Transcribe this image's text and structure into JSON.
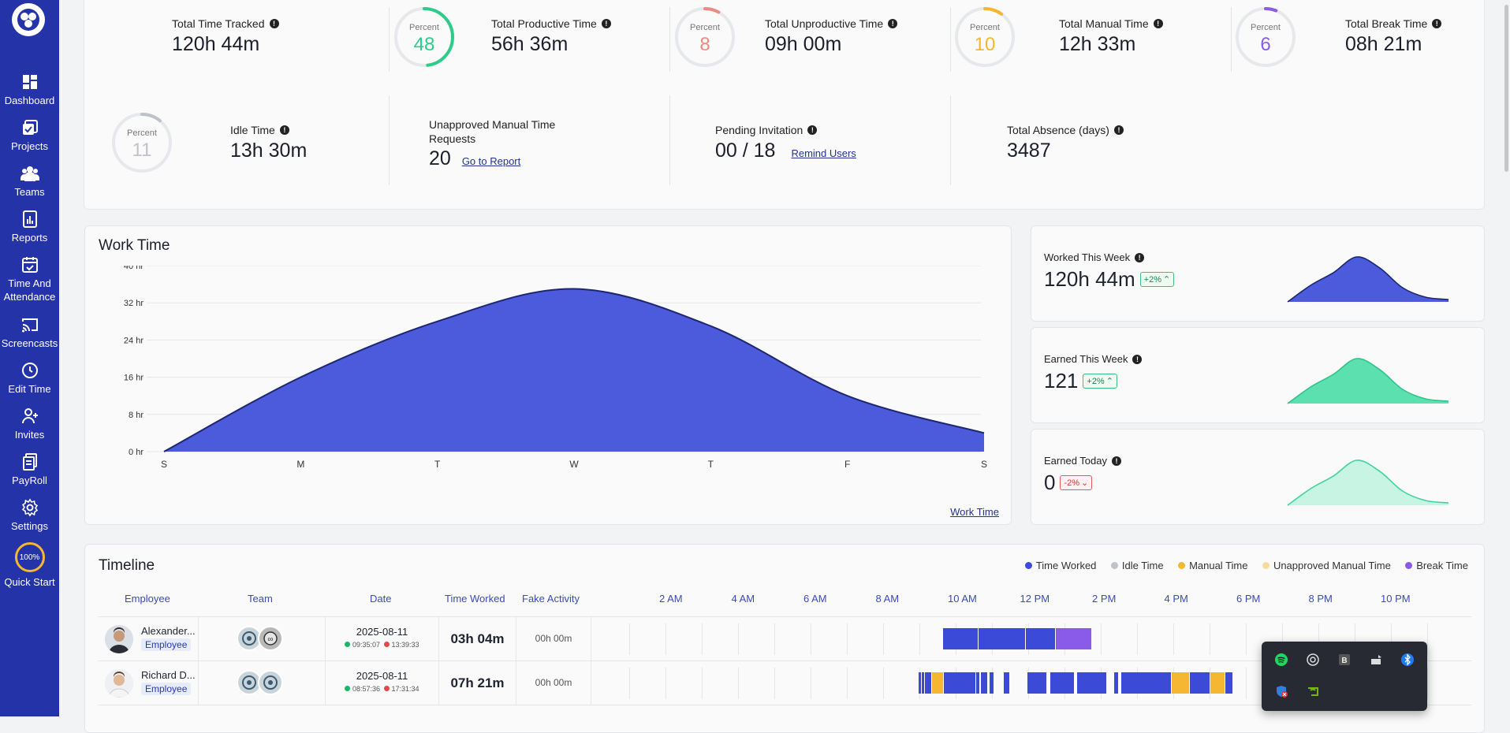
{
  "sidebar": {
    "items": [
      {
        "label": "Dashboard",
        "icon": "dashboard-icon"
      },
      {
        "label": "Projects",
        "icon": "projects-icon"
      },
      {
        "label": "Teams",
        "icon": "teams-icon"
      },
      {
        "label": "Reports",
        "icon": "reports-icon"
      },
      {
        "label": "Time And Attendance",
        "icon": "calendar-icon"
      },
      {
        "label": "Screencasts",
        "icon": "screencast-icon"
      },
      {
        "label": "Edit Time",
        "icon": "clock-icon"
      },
      {
        "label": "Invites",
        "icon": "add-user-icon"
      },
      {
        "label": "PayRoll",
        "icon": "payroll-icon"
      },
      {
        "label": "Settings",
        "icon": "gear-icon"
      }
    ],
    "quick_start": {
      "label": "Quick Start",
      "percent": "100%"
    }
  },
  "stats": {
    "total_time_tracked": {
      "label": "Total Time Tracked",
      "value": "120h 44m"
    },
    "productive": {
      "label": "Total Productive Time",
      "value": "56h 36m",
      "percent_label": "Percent",
      "percent": "48",
      "color": "#2ecc8a"
    },
    "unproductive": {
      "label": "Total Unproductive Time",
      "value": "09h 00m",
      "percent_label": "Percent",
      "percent": "8",
      "color": "#f08a80"
    },
    "manual": {
      "label": "Total Manual Time",
      "value": "12h 33m",
      "percent_label": "Percent",
      "percent": "10",
      "color": "#f5b731"
    },
    "break": {
      "label": "Total Break Time",
      "value": "08h 21m",
      "percent_label": "Percent",
      "percent": "6",
      "color": "#8a5be8"
    },
    "idle": {
      "label": "Idle Time",
      "value": "13h 30m",
      "percent_label": "Percent",
      "percent": "11",
      "color": "#bfc2c8"
    },
    "unapproved": {
      "label": "Unapproved Manual Time Requests",
      "value": "20",
      "link": "Go to Report"
    },
    "pending": {
      "label": "Pending Invitation",
      "value": "00 / 18",
      "link": "Remind Users"
    },
    "absence": {
      "label": "Total Absence (days)",
      "value": "3487"
    }
  },
  "work_time": {
    "title": "Work Time",
    "footer_link": "Work Time"
  },
  "chart_data": {
    "type": "area",
    "categories": [
      "S",
      "M",
      "T",
      "W",
      "T",
      "F",
      "S"
    ],
    "y_ticks": [
      "0 hr",
      "8 hr",
      "16 hr",
      "24 hr",
      "32 hr",
      "40 hr"
    ],
    "ylim": [
      0,
      40
    ],
    "series": [
      {
        "values": [
          0,
          16,
          28,
          35,
          27,
          12,
          4
        ]
      }
    ],
    "color": "#4b5bdc"
  },
  "mini_cards": [
    {
      "title": "Worked This Week",
      "value": "120h 44m",
      "badge": "+2%",
      "trend": "up",
      "color": "#4b5bdc"
    },
    {
      "title": "Earned This Week",
      "value": "121",
      "badge": "+2%",
      "trend": "up",
      "color": "#5de0b0"
    },
    {
      "title": "Earned Today",
      "value": "0",
      "badge": "-2%",
      "trend": "down",
      "color": "#c8f4e3"
    }
  ],
  "timeline": {
    "title": "Timeline",
    "legend": [
      {
        "label": "Time Worked",
        "color": "#3b4bd8"
      },
      {
        "label": "Idle Time",
        "color": "#bfc2c8"
      },
      {
        "label": "Manual Time",
        "color": "#f5b731"
      },
      {
        "label": "Unapproved Manual Time",
        "color": "#f6dc9a"
      },
      {
        "label": "Break Time",
        "color": "#8a5be8"
      }
    ],
    "columns": [
      "Employee",
      "Team",
      "Date",
      "Time Worked",
      "Fake Activity"
    ],
    "hours": [
      "2 AM",
      "4 AM",
      "6 AM",
      "8 AM",
      "10 AM",
      "12 PM",
      "2 PM",
      "4 PM",
      "6 PM",
      "8 PM",
      "10 PM"
    ],
    "rows": [
      {
        "name": "Alexander...",
        "role": "Employee",
        "date": "2025-08-11",
        "start": "09:35:07",
        "end": "13:39:33",
        "worked": "03h 04m",
        "fake": "00h 00m"
      },
      {
        "name": "Richard D...",
        "role": "Employee",
        "date": "2025-08-11",
        "start": "08:57:36",
        "end": "17:31:34",
        "worked": "07h 21m",
        "fake": "00h 00m"
      }
    ]
  },
  "tray_icons": [
    "spotify-icon",
    "chatgpt-icon",
    "b-app-icon",
    "network-icon",
    "bluetooth-icon",
    "shield-x-icon",
    "nvidia-icon"
  ]
}
